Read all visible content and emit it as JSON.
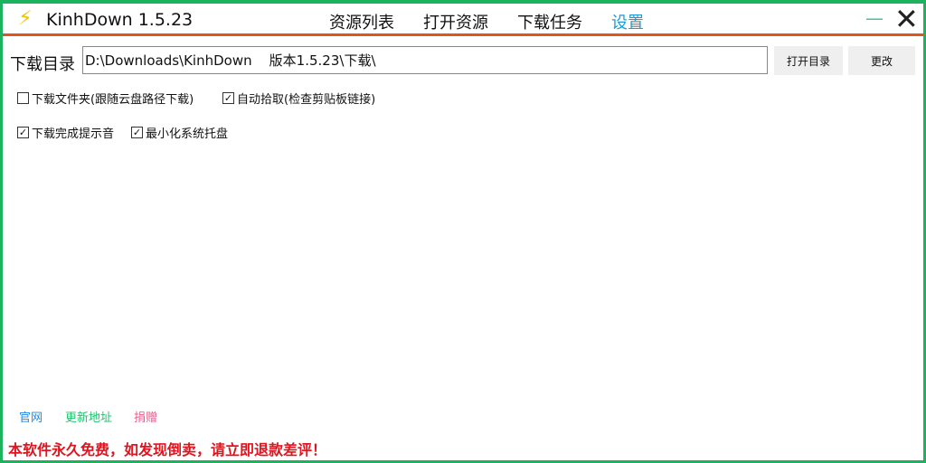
{
  "app": {
    "title": "KinhDown 1.5.23",
    "logo_icon": "lightning-icon"
  },
  "nav": [
    "资源列表",
    "打开资源",
    "下载任务",
    "设置"
  ],
  "active_nav": "设置",
  "window": {
    "minimize": "—",
    "close": "✕"
  },
  "settings": {
    "dir_label": "下载目录",
    "dir_value": "D:\\Downloads\\KinhDown    版本1.5.23\\下载\\",
    "open_dir": "打开目录",
    "change": "更改",
    "options": [
      {
        "label": "下载文件夹(跟随云盘路径下载)",
        "checked": false
      },
      {
        "label": "自动拾取(检查剪贴板链接)",
        "checked": true
      },
      {
        "label": "下载完成提示音",
        "checked": true
      },
      {
        "label": "最小化系统托盘",
        "checked": true
      }
    ]
  },
  "footer": {
    "links": [
      "官网",
      "更新地址",
      "捐赠"
    ],
    "notice": "本软件永久免费，如发现倒卖，请立即退款差评！"
  },
  "colors": {
    "accent": "#1e9ad6",
    "border": "#1db35e",
    "divider": "#e0561a",
    "warn": "#e0141e"
  }
}
